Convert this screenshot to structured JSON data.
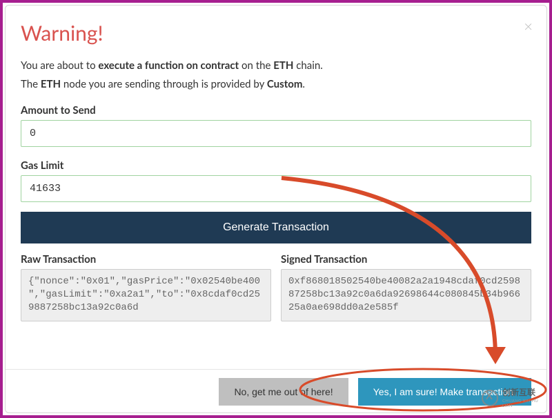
{
  "title": "Warning!",
  "line1_parts": {
    "p1": "You are about to ",
    "p2": "execute a function on contract",
    "p3": " on the ",
    "p4": "ETH",
    "p5": " chain."
  },
  "line2_parts": {
    "p1": "The ",
    "p2": "ETH",
    "p3": " node you are sending through is provided by ",
    "p4": "Custom",
    "p5": "."
  },
  "amount": {
    "label": "Amount to Send",
    "value": "0"
  },
  "gas": {
    "label": "Gas Limit",
    "value": "41633"
  },
  "generate_label": "Generate Transaction",
  "raw": {
    "label": "Raw Transaction",
    "value": "{\"nonce\":\"0x01\",\"gasPrice\":\"0x02540be400\",\"gasLimit\":\"0xa2a1\",\"to\":\"0x8cdaf0cd259887258bc13a92c0a6d"
  },
  "signed": {
    "label": "Signed Transaction",
    "value": "0xf868018502540be40082a2a1948cdaf0cd259887258bc13a92c0a6da92698644c080845b34b96625a0ae698dd0a2e585f"
  },
  "cancel_label": "No, get me out of here!",
  "confirm_label": "Yes, I am sure! Make transaction.",
  "watermark": {
    "main": "创新互联",
    "sub": "CHUANG XIN HU LIAN"
  }
}
